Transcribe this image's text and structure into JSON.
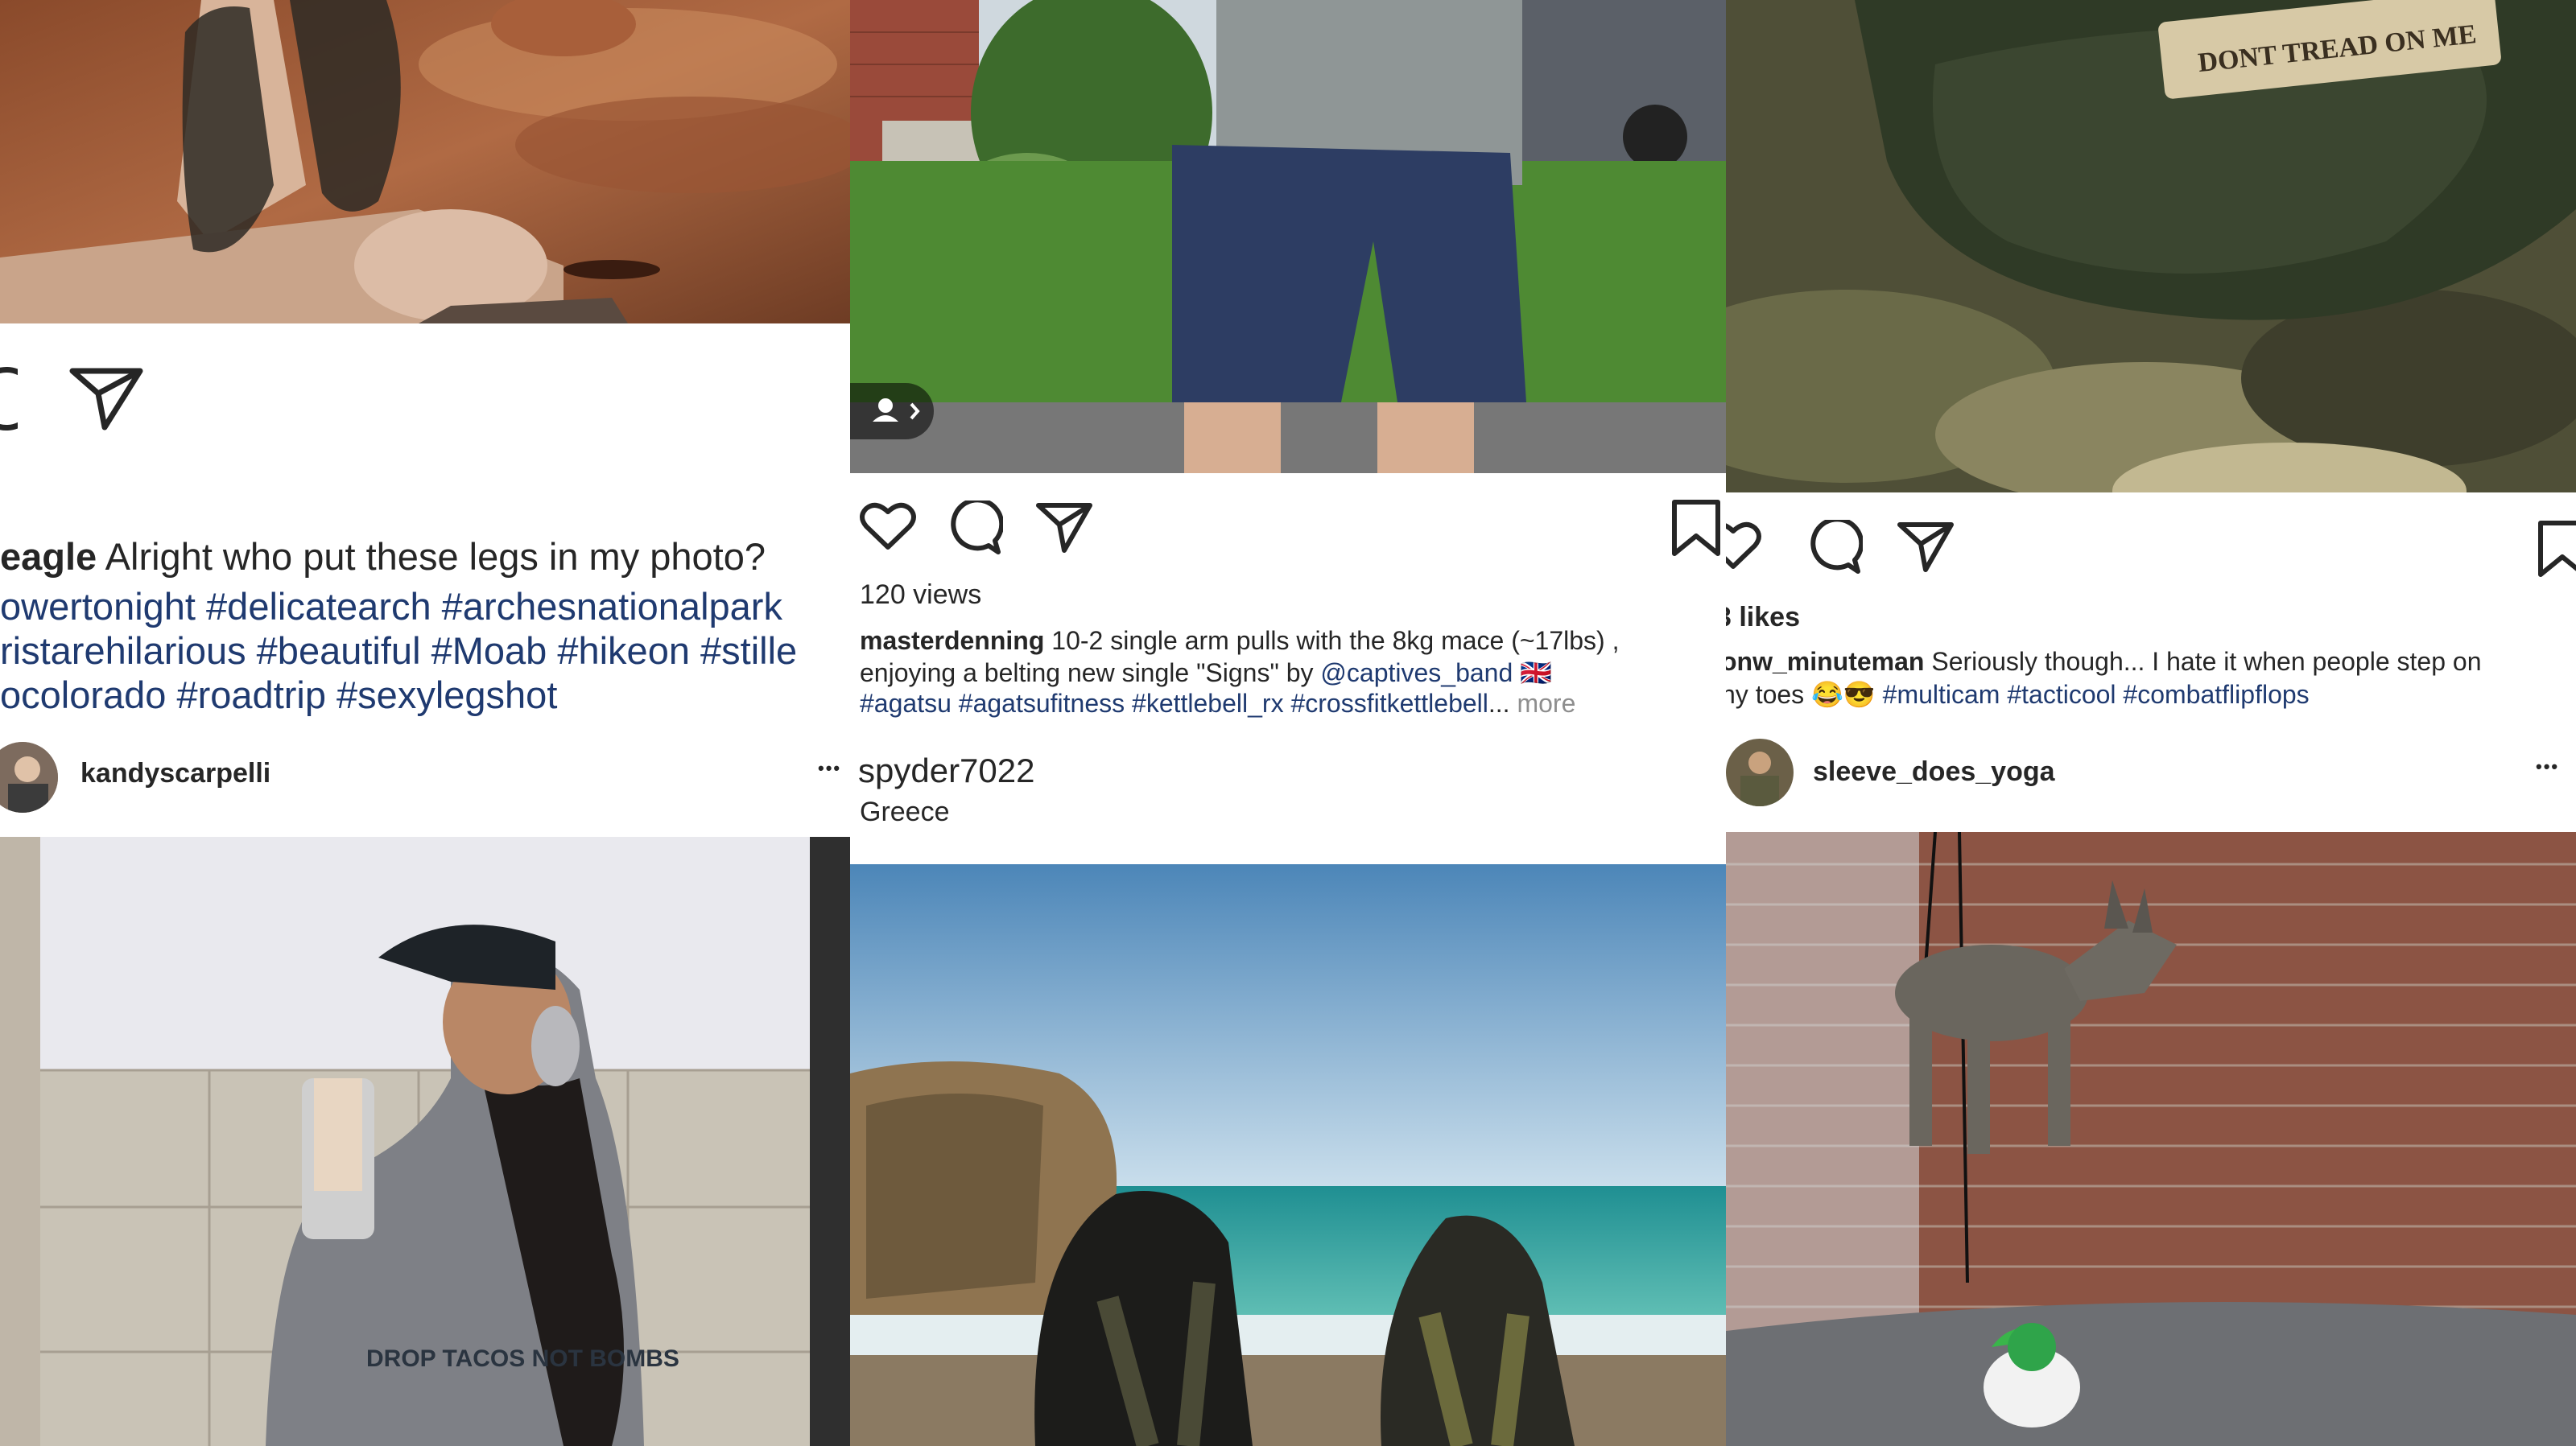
{
  "post1": {
    "caption_user_partial": "eagle",
    "caption_text": " Alright who put these legs in my photo?",
    "hashtag_lines": [
      "owertonight #delicatearch #archesnationalpark",
      "ristarehilarious #beautiful #Moab #hikeon #stille",
      "ocolorado #roadtrip #sexylegshot"
    ]
  },
  "post_kandy": {
    "username": "kandyscarpelli",
    "more": "•••",
    "shirt_text": "DROP TACOS NOT BOMBS"
  },
  "post2": {
    "views": "120 views",
    "caption_user": "masterdenning",
    "caption_line1": " 10-2 single arm pulls with the 8kg mace (~17lbs) ,",
    "caption_line2_pre": "enjoying a belting new single \"Signs\" by ",
    "caption_mention": "@captives_band",
    "caption_flag": " 🇬🇧",
    "caption_line3": "#agatsu #agatsufitness #kettlebell_rx #crossfitkettlebell",
    "ellipsis": "...",
    "more_label": "more"
  },
  "post_spyder": {
    "username": "spyder7022",
    "location": "Greece"
  },
  "post3": {
    "likes_partial": "3 likes",
    "caption_user_partial": "onw_minuteman",
    "caption_text": " Seriously though... I hate it when people step on",
    "caption_line2_pre": "ny toes 😂😎 ",
    "caption_tags": "#multicam #tacticool #combatflipflops",
    "patch_text": "DONT TREAD ON ME"
  },
  "post_sleeve": {
    "username": "sleeve_does_yoga",
    "more": "•••"
  },
  "colors": {
    "hashtag": "#1f3a70",
    "text": "#262626",
    "muted": "#8e8e8e"
  }
}
